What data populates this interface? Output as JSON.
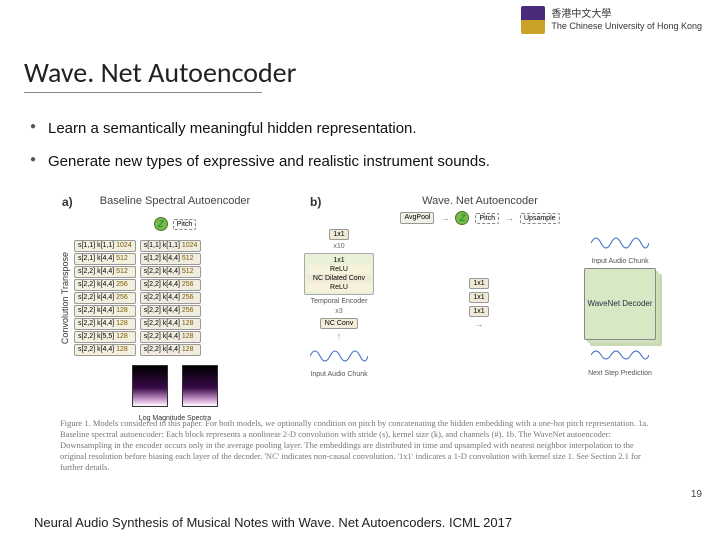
{
  "university": {
    "name_zh": "香港中文大學",
    "name_en": "The Chinese University of Hong Kong"
  },
  "title": "Wave. Net Autoencoder",
  "bullets": [
    "Learn a semantically meaningful hidden representation.",
    "Generate new types of expressive and realistic instrument sounds."
  ],
  "figure": {
    "panel_a": {
      "label": "a)",
      "title": "Baseline Spectral Autoencoder",
      "conv_transpose_label": "Convolution Transpose",
      "pitch": "Pitch",
      "z": "Z",
      "encoder_blocks": [
        {
          "s": "s[1,1]",
          "k": "k[1,1]",
          "ch": "1024"
        },
        {
          "s": "s[2,1]",
          "k": "k[4,4]",
          "ch": "512"
        },
        {
          "s": "s[2,2]",
          "k": "k[4,4]",
          "ch": "512"
        },
        {
          "s": "s[2,2]",
          "k": "k[4,4]",
          "ch": "256"
        },
        {
          "s": "s[2,2]",
          "k": "k[4,4]",
          "ch": "256"
        },
        {
          "s": "s[2,2]",
          "k": "k[4,4]",
          "ch": "128"
        },
        {
          "s": "s[2,2]",
          "k": "k[4,4]",
          "ch": "128"
        },
        {
          "s": "s[2,2]",
          "k": "k[5,5]",
          "ch": "128"
        },
        {
          "s": "s[2,2]",
          "k": "k[4,4]",
          "ch": "128"
        }
      ],
      "decoder_blocks": [
        {
          "s": "s[1,1]",
          "k": "k[1,1]",
          "ch": "1024"
        },
        {
          "s": "s[1,2]",
          "k": "k[4,4]",
          "ch": "512"
        },
        {
          "s": "s[2,2]",
          "k": "k[4,4]",
          "ch": "512"
        },
        {
          "s": "s[2,2]",
          "k": "k[4,4]",
          "ch": "256"
        },
        {
          "s": "s[2,2]",
          "k": "k[4,4]",
          "ch": "256"
        },
        {
          "s": "s[2,2]",
          "k": "k[4,4]",
          "ch": "256"
        },
        {
          "s": "s[2,2]",
          "k": "k[4,4]",
          "ch": "128"
        },
        {
          "s": "s[2,2]",
          "k": "k[4,4]",
          "ch": "128"
        },
        {
          "s": "s[2,2]",
          "k": "k[4,4]",
          "ch": "128"
        }
      ],
      "spectra_label": "Log Magnitude\nSpectra"
    },
    "panel_b": {
      "label": "b)",
      "title": "Wave. Net Autoencoder",
      "avgpool": "AvgPool",
      "z": "Z",
      "pitch": "Pitch",
      "upsample": "Upsample",
      "onebyone": "1x1",
      "x10": "x10",
      "relu": "ReLU",
      "nc_dilated": "NC Dilated Conv",
      "temporal_encoder": "Temporal\nEncoder",
      "x3": "x3",
      "nc_conv": "NC Conv",
      "input_chunk": "Input\nAudio Chunk",
      "wavenet_decoder": "WaveNet\nDecoder",
      "next_step": "Next Step\nPrediction"
    },
    "caption": "Figure 1. Models considered in this paper. For both models, we optionally condition on pitch by concatenating the hidden embedding with a one-hot pitch representation. 1a. Baseline spectral autoencoder: Each block represents a nonlinear 2-D convolution with stride (s), kernel size (k), and channels (#). 1b. The WaveNet autoencoder: Downsampling in the encoder occurs only in the average pooling layer. The embeddings are distributed in time and upsampled with nearest neighbor interpolation to the original resolution before biasing each layer of the decoder. 'NC' indicates non-causal convolution. '1x1' indicates a 1-D convolution with kernel size 1. See Section 2.1 for further details."
  },
  "footer_cite": "Neural Audio Synthesis of Musical Notes with Wave. Net Autoencoders. ICML 2017",
  "page_num": "19"
}
